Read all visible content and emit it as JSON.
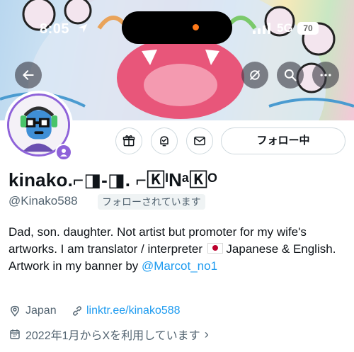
{
  "status_bar": {
    "time": "8:05",
    "network": "5G",
    "battery": "70"
  },
  "banner": {
    "description_icons": [
      "back-arrow-icon",
      "mute-icon",
      "search-icon",
      "more-icon"
    ]
  },
  "actions": {
    "following_label": "フォロー中"
  },
  "profile": {
    "display_name": "kinako.⌐◨-◨. ⌐🄺ᴵNᵃ🄺ᴼ",
    "handle": "@Kinako588",
    "follows_you": "フォローされています",
    "bio_text": "Dad, son. daughter. Not artist but promoter for my wife's artworks. I am translator / interpreter ",
    "bio_text_2": " Japanese & English. Artwork in my banner by ",
    "bio_mention": "@Marcot_no1",
    "location": "Japan",
    "link": "linktr.ee/kinako588",
    "joined": "2022年1月からXを利用しています"
  },
  "colors": {
    "accent": "#1d9bf0",
    "avatar_ring": "#8e62d9",
    "secondary_text": "#536471"
  }
}
